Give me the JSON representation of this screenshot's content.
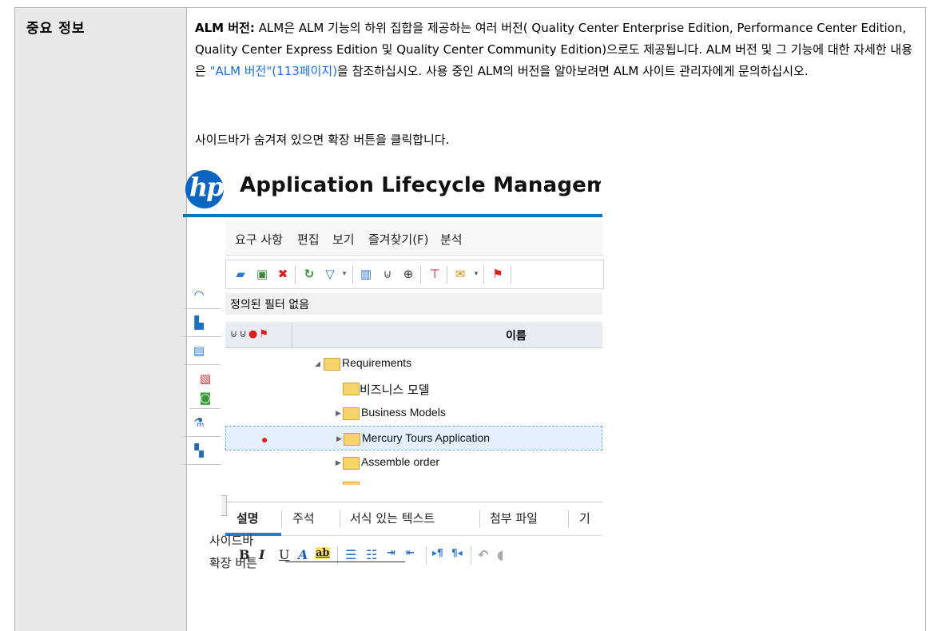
{
  "table": {
    "left_label": "중요 정보",
    "para1": {
      "term": "ALM 버전:",
      "text_a": " ALM은 ALM 기능의 하위 집합을 제공하는 여러 버전( Quality Center Enterprise Edition, Performance Center Edition, Quality Center Express Edition 및 Quality Center Community Edition)으로도 제공됩니다. ALM 버전 및 그 기능에 대한 자세한 내용은 ",
      "link": "\"ALM 버전\"(113페이지)",
      "text_b": "을 참조하십시오. 사용 중인 ALM의 버전을 알아보려면 ALM 사이트 관리자에게 문의하십시오."
    },
    "para2": "사이드바가 숨겨져 있으면 확장 버튼을 클릭합니다."
  },
  "screenshot": {
    "logo": "hp",
    "app_title": "Application Lifecycle Management",
    "menu": [
      "요구 사항",
      "편집",
      "보기",
      "즐겨찾기(F)",
      "분석"
    ],
    "filter_text": "정의된 필터 없음",
    "column_name": "이름",
    "tree": [
      {
        "label": "Requirements",
        "expanded": true,
        "selected": false,
        "alert": false
      },
      {
        "label": "비즈니스 모델",
        "expanded": null,
        "selected": false,
        "alert": false
      },
      {
        "label": "Business Models",
        "expanded": false,
        "selected": false,
        "alert": false
      },
      {
        "label": "Mercury Tours Application",
        "expanded": false,
        "selected": true,
        "alert": true
      },
      {
        "label": "Assemble order",
        "expanded": false,
        "selected": false,
        "alert": false
      }
    ],
    "tabs": [
      "설명",
      "주석",
      "서식 있는 텍스트",
      "첨부 파일",
      "기"
    ],
    "sidebar_icons": [
      "dashboard-icon",
      "analysis-icon",
      "requirements-icon",
      "test-plan-icon",
      "test-resources-icon",
      "test-lab-icon",
      "defects-icon"
    ],
    "toolbar_icons": [
      "new-folder-icon",
      "new-requirement-icon",
      "delete-icon",
      "refresh-icon",
      "filter-icon",
      "select-columns-icon",
      "attachment-icon",
      "find-icon",
      "pin-icon",
      "mail-icon",
      "flag-icon"
    ],
    "format_buttons": [
      "B",
      "I",
      "U",
      "A",
      "ab"
    ]
  },
  "callout": {
    "line1": "사이드바",
    "line2": "확장 버튼"
  }
}
